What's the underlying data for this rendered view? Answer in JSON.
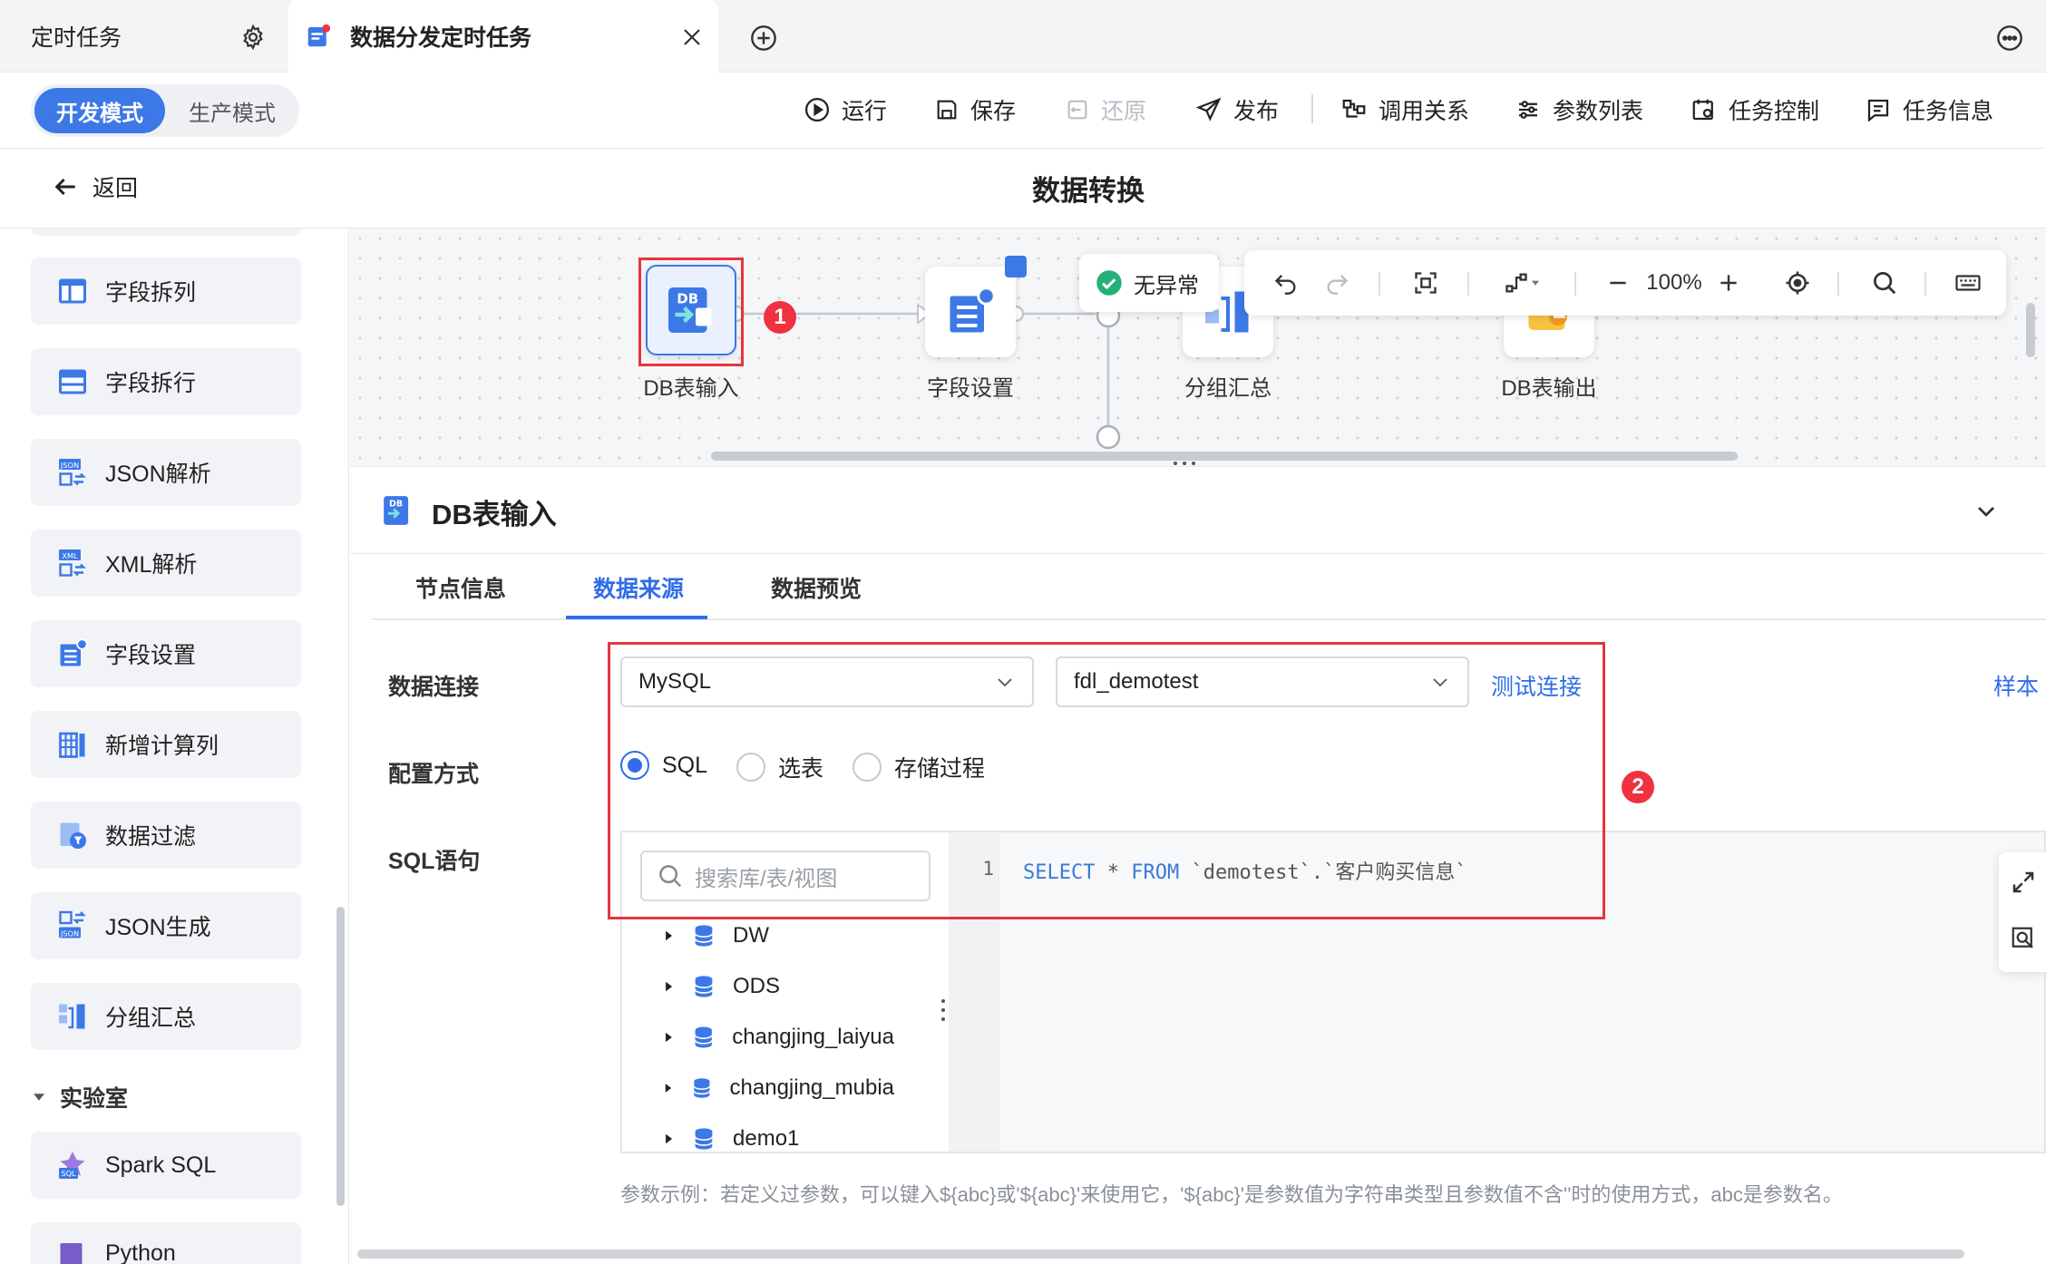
{
  "tabs": {
    "inactive_label": "定时任务",
    "active_label": "数据分发定时任务"
  },
  "toolbar": {
    "mode_dev": "开发模式",
    "mode_prod": "生产模式",
    "run": "运行",
    "save": "保存",
    "restore": "还原",
    "publish": "发布",
    "relations": "调用关系",
    "params": "参数列表",
    "task_control": "任务控制",
    "task_info": "任务信息"
  },
  "header": {
    "back_label": "返回",
    "title": "数据转换"
  },
  "sidebar": {
    "items": [
      {
        "label": "字段拆列",
        "icon": "split-columns-icon"
      },
      {
        "label": "字段拆行",
        "icon": "split-rows-icon"
      },
      {
        "label": "JSON解析",
        "icon": "json-parse-icon"
      },
      {
        "label": "XML解析",
        "icon": "xml-parse-icon"
      },
      {
        "label": "字段设置",
        "icon": "field-settings-icon"
      },
      {
        "label": "新增计算列",
        "icon": "calc-column-icon"
      },
      {
        "label": "数据过滤",
        "icon": "filter-icon"
      },
      {
        "label": "JSON生成",
        "icon": "json-generate-icon"
      },
      {
        "label": "分组汇总",
        "icon": "group-summary-icon"
      }
    ],
    "group_label": "实验室",
    "lab_items": [
      {
        "label": "Spark SQL",
        "icon": "spark-sql-icon"
      },
      {
        "label": "Python",
        "icon": "python-icon"
      }
    ]
  },
  "canvas": {
    "nodes": [
      {
        "label": "DB表输入"
      },
      {
        "label": "字段设置"
      },
      {
        "label": "分组汇总"
      },
      {
        "label": "DB表输出"
      }
    ],
    "badge1": "1",
    "status_label": "无异常",
    "zoom": "100%"
  },
  "panel": {
    "title": "DB表输入",
    "tabs": [
      "节点信息",
      "数据来源",
      "数据预览"
    ],
    "active_tab": "数据来源",
    "labels": {
      "connection": "数据连接",
      "config_mode": "配置方式",
      "sql": "SQL语句"
    },
    "connection_type": "MySQL",
    "connection_name": "fdl_demotest",
    "test_link": "测试连接",
    "right_link": "样本",
    "radio_options": [
      "SQL",
      "选表",
      "存储过程"
    ],
    "radio_selected": "SQL",
    "search_placeholder": "搜索库/表/视图",
    "tree": [
      "DW",
      "ODS",
      "changjing_laiyua",
      "changjing_mubia",
      "demo1"
    ],
    "line_number": "1",
    "sql_keyword_select": "SELECT",
    "sql_star": " * ",
    "sql_keyword_from": "FROM",
    "sql_rest": " `demotest`.`客户购买信息`",
    "badge2": "2",
    "hint": "参数示例：若定义过参数，可以键入${abc}或'${abc}'来使用它，'${abc}'是参数值为字符串类型且参数值不含''时的使用方式，abc是参数名。"
  },
  "colors": {
    "accent": "#2f6ee8",
    "highlight_red": "#e8343f"
  }
}
